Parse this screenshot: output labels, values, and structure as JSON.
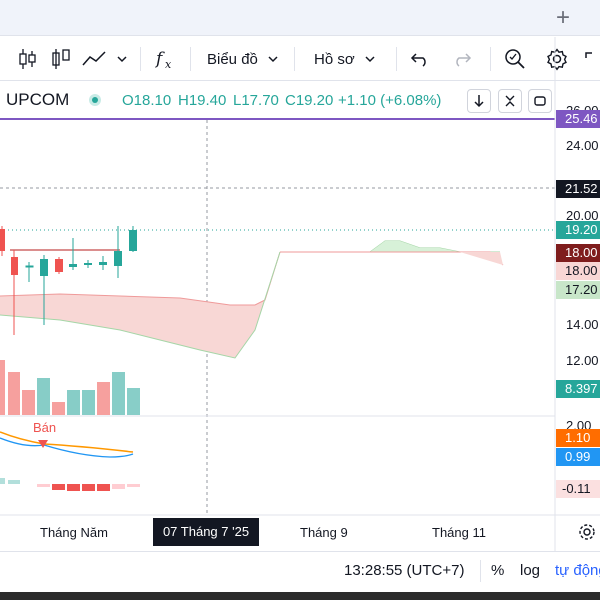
{
  "toolbar": {
    "chart_label": "Biểu đồ",
    "profile_label": "Hồ sơ"
  },
  "legend": {
    "exchange": "UPCOM",
    "open": "O18.10",
    "high": "H19.40",
    "low": "L17.70",
    "close": "C19.20",
    "change": "+1.10 (+6.08%)"
  },
  "price_axis": {
    "ticks": [
      "26.00",
      "24.00",
      "20.00",
      "14.00",
      "12.00",
      "2.00"
    ],
    "tags": {
      "top": "25.46",
      "crosshair": "21.52",
      "last": "19.20",
      "dark": "18.00",
      "pink": "18.00",
      "green": "17.20",
      "volume": "8.397",
      "macd_orange": "1.10",
      "macd_blue": "0.99",
      "hist": "-0.11"
    }
  },
  "signal_label": "Bán",
  "time_axis": {
    "labels": [
      "Tháng Năm",
      "Tháng 9",
      "Tháng 11"
    ],
    "crosshair_date": "07 Tháng 7 '25"
  },
  "status": {
    "time": "13:28:55 (UTC+7)",
    "percent": "%",
    "log": "log",
    "auto": "tự động"
  },
  "colors": {
    "up": "#26a69a",
    "down": "#ef5350",
    "accent": "#2962ff",
    "purple": "#7e57c2",
    "macd": "#2196f3",
    "signal": "#ff6d00"
  }
}
